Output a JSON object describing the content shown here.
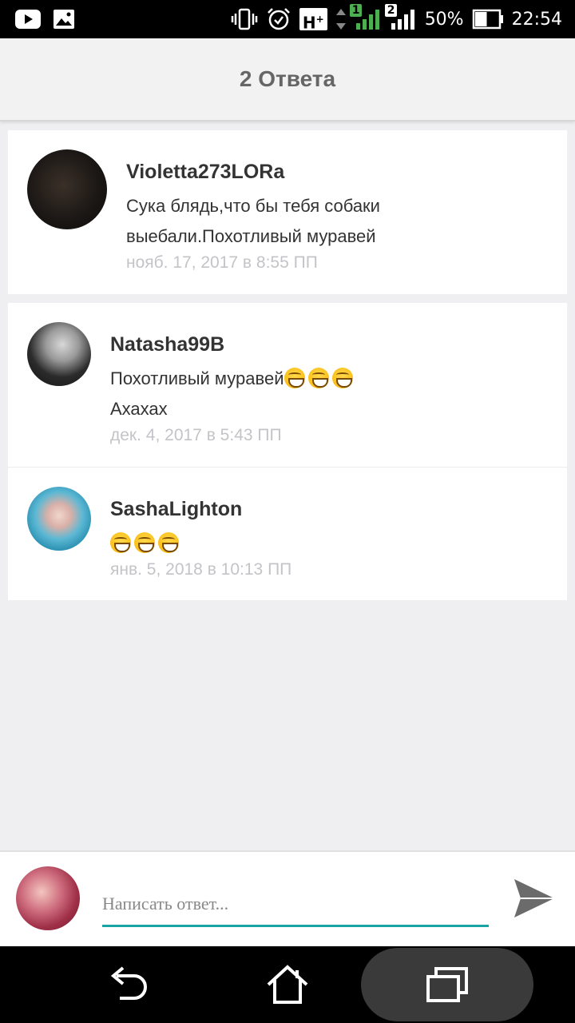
{
  "status_bar": {
    "icons_left": [
      "youtube-icon",
      "image-icon"
    ],
    "icons_right": [
      "vibrate-icon",
      "alarm-icon",
      "signal-icon"
    ],
    "network_type": "H",
    "network_plus": "+",
    "sim1": "1",
    "sim2": "2",
    "battery": "50%",
    "battery_level": 0.5,
    "time": "22:54"
  },
  "header": {
    "title": "2 Ответа"
  },
  "parent_comment": {
    "username": "Violetta273LORa",
    "text_line1": "Сука блядь,что бы тебя собаки",
    "text_line2": "выебали.Похотливый муравей",
    "date": "нояб. 17, 2017 в 8:55 ПП"
  },
  "replies": [
    {
      "username": "Natasha99B",
      "text_line1": "Похотливый муравей",
      "text_line2": "Ахахах",
      "emoji": "grinning-squinting-face",
      "date": "дек. 4, 2017 в 5:43 ПП"
    },
    {
      "username": "SashaLighton",
      "emoji": "grinning-squinting-face",
      "date": "янв. 5, 2018 в 10:13 ПП"
    }
  ],
  "reply_box": {
    "placeholder": "Написать ответ...",
    "value": ""
  },
  "nav": {
    "icons": [
      "back-icon",
      "home-icon",
      "recents-icon"
    ]
  },
  "colors": {
    "accent": "#1aa3a5",
    "date_gray": "#c4c4c8",
    "background": "#efeef0"
  }
}
